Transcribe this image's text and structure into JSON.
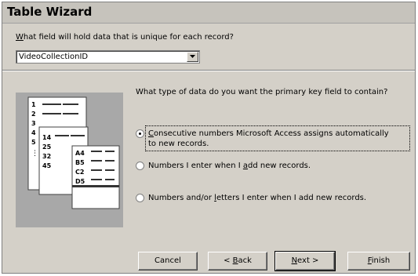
{
  "window": {
    "title": "Table Wizard"
  },
  "question": {
    "accel": "W",
    "rest": "hat field will hold data that is unique for each record?"
  },
  "field_combo": {
    "value": "VideoCollectionID"
  },
  "prompt": "What type of data do you want the primary key field to contain?",
  "illustration": {
    "rows1": [
      "1",
      "2",
      "3",
      "4",
      "5"
    ],
    "rows2": [
      "14",
      "25",
      "32",
      "45"
    ],
    "rows3": [
      "A4",
      "B5",
      "C2",
      "D5"
    ]
  },
  "options": [
    {
      "accel": "C",
      "rest": "onsecutive numbers Microsoft Access assigns automatically",
      "line2": "to new records.",
      "selected": true
    },
    {
      "pre": "Numbers I enter when I ",
      "accel": "a",
      "rest": "dd new records.",
      "selected": false
    },
    {
      "pre": "Numbers and/or ",
      "accel": "l",
      "rest": "etters I enter when I add new records.",
      "selected": false
    }
  ],
  "buttons": {
    "cancel": "Cancel",
    "back_pre": "< ",
    "back_accel": "B",
    "back_rest": "ack",
    "next_accel": "N",
    "next_rest": "ext >",
    "finish_accel": "F",
    "finish_rest": "inish"
  }
}
